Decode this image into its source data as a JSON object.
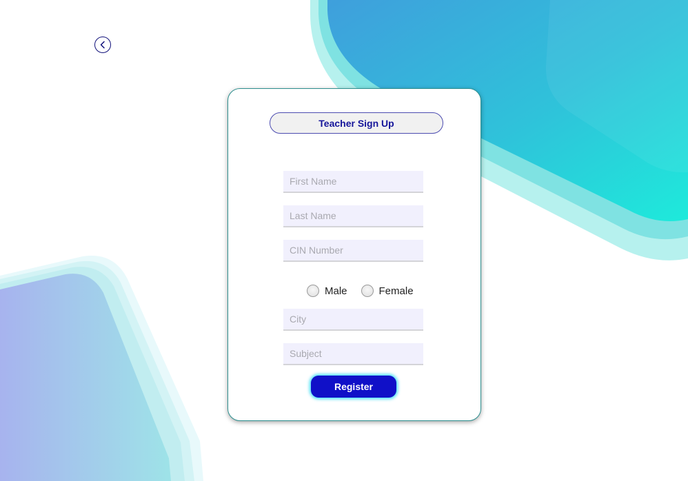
{
  "header": {
    "back_icon": "chevron-left-icon"
  },
  "form": {
    "title": "Teacher Sign Up",
    "first_name": {
      "placeholder": "First Name",
      "value": ""
    },
    "last_name": {
      "placeholder": "Last Name",
      "value": ""
    },
    "cin_number": {
      "placeholder": "CIN Number",
      "value": ""
    },
    "gender": {
      "options": [
        {
          "label": "Male",
          "selected": false
        },
        {
          "label": "Female",
          "selected": false
        }
      ]
    },
    "city": {
      "placeholder": "City",
      "value": ""
    },
    "subject": {
      "placeholder": "Subject",
      "value": ""
    },
    "register_label": "Register"
  },
  "colors": {
    "accent": "#1010c8",
    "title_text": "#15159a",
    "card_border": "#2d8f8f",
    "input_bg": "#f1f0fd",
    "bg_shape_blue": "#3ba8dc",
    "bg_shape_teal": "#1ee8d8"
  }
}
